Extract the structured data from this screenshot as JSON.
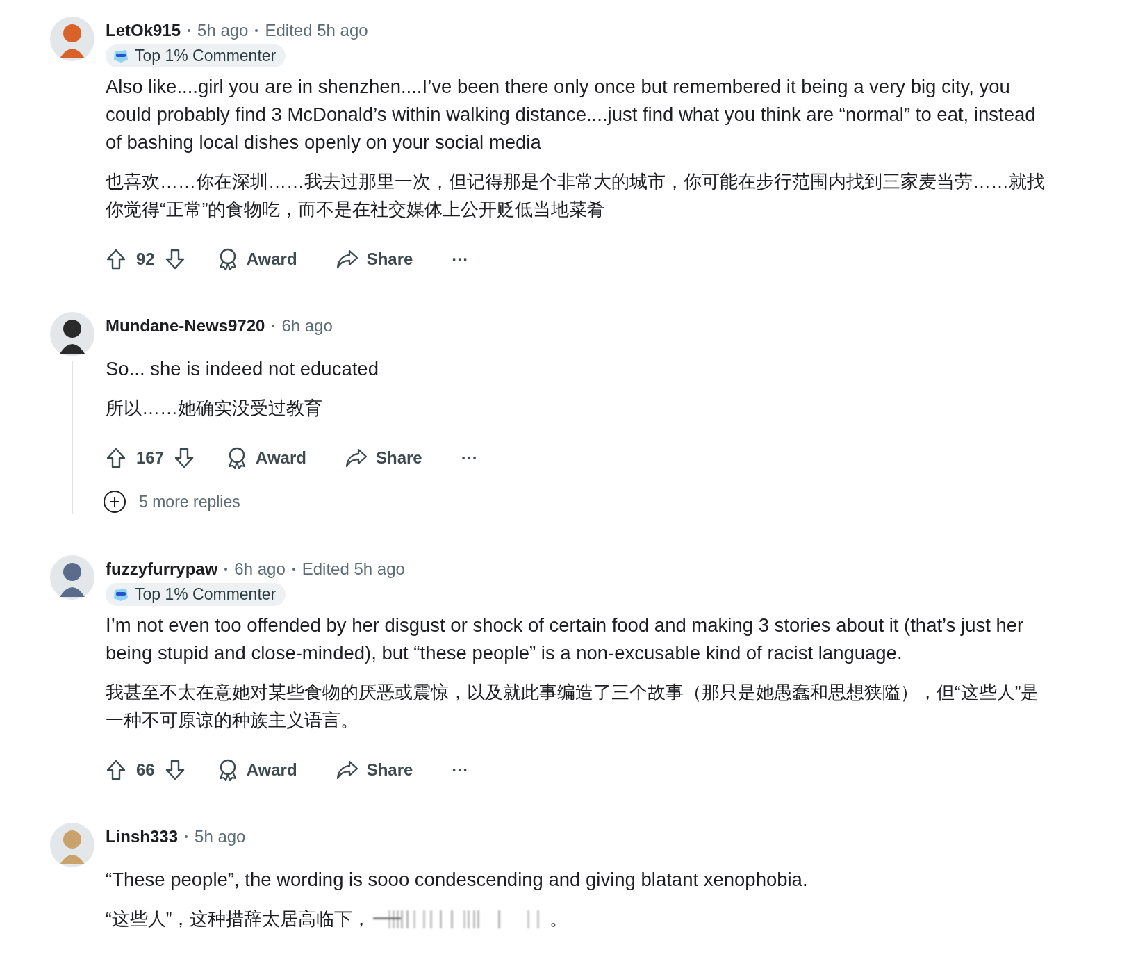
{
  "comments": [
    {
      "author": "LetOk915",
      "time": "5h ago",
      "edited": "Edited 5h ago",
      "badge": "Top 1% Commenter",
      "body": "Also like....girl you are in shenzhen....I’ve been there only once but remembered it being a very big city, you could probably find 3 McDonald’s within walking distance....just find what you think are “normal” to eat, instead of bashing local dishes openly on your social media",
      "translation": "也喜欢……你在深圳……我去过那里一次，但记得那是个非常大的城市，你可能在步行范围内找到三家麦当劳……就找你觉得“正常”的食物吃，而不是在社交媒体上公开贬低当地菜肴",
      "votes": "92",
      "award": "Award",
      "share": "Share",
      "more": "···"
    },
    {
      "author": "Mundane-News9720",
      "time": "6h ago",
      "body": "So... she is indeed not educated",
      "translation": "所以……她确实没受过教育",
      "votes": "167",
      "award": "Award",
      "share": "Share",
      "more": "···",
      "more_replies": "5 more replies"
    },
    {
      "author": "fuzzyfurrypaw",
      "time": "6h ago",
      "edited": "Edited 5h ago",
      "badge": "Top 1% Commenter",
      "body": "I’m not even too offended by her disgust or shock of certain food and making 3 stories about it (that’s just her being stupid and close-minded), but “these people” is a non-excusable kind of racist language.",
      "translation": "我甚至不太在意她对某些食物的厌恶或震惊，以及就此事编造了三个故事（那只是她愚蠢和思想狭隘），但“这些人”是一种不可原谅的种族主义语言。",
      "votes": "66",
      "award": "Award",
      "share": "Share",
      "more": "···"
    },
    {
      "author": "Linsh333",
      "time": "5h ago",
      "body": "“These people”, the wording is sooo condescending and giving blatant xenophobia.",
      "translation": "“这些人”，这种措辞太居高临下，",
      "translation_end": "。"
    }
  ]
}
